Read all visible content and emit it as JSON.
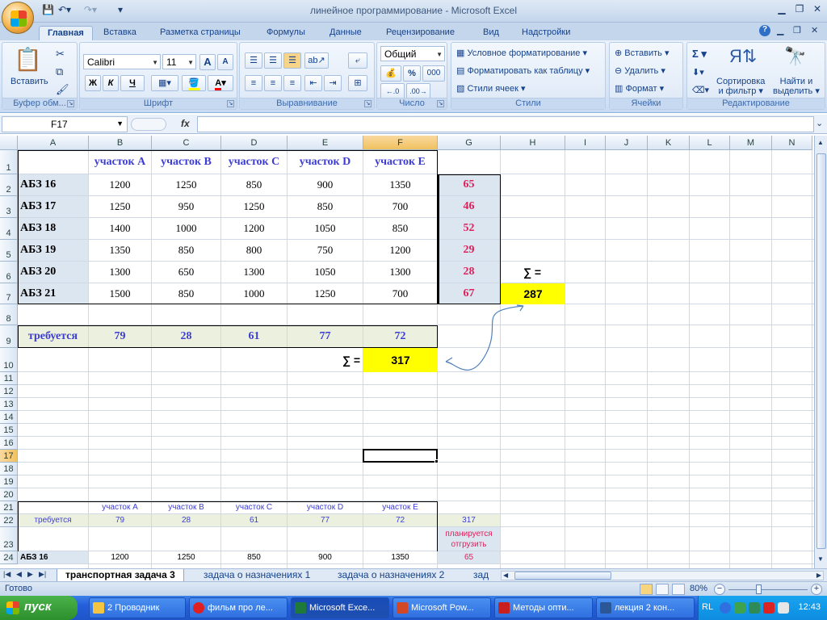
{
  "window": {
    "title": "линейное программирование - Microsoft Excel"
  },
  "ribbon_tabs": [
    "Главная",
    "Вставка",
    "Разметка страницы",
    "Формулы",
    "Данные",
    "Рецензирование",
    "Вид",
    "Надстройки"
  ],
  "ribbon": {
    "clipboard": {
      "paste": "Вставить",
      "label": "Буфер обм..."
    },
    "font": {
      "name": "Calibri",
      "size": "11",
      "bold": "Ж",
      "italic": "К",
      "underline": "Ч",
      "grow": "A",
      "shrink": "A",
      "color_letter": "A",
      "label": "Шрифт"
    },
    "alignment": {
      "label": "Выравнивание"
    },
    "number": {
      "format": "Общий",
      "percent": "%",
      "thousands": "000",
      "label": "Число"
    },
    "styles": {
      "conditional": "Условное форматирование",
      "as_table": "Форматировать как таблицу",
      "cell_styles": "Стили ячеек",
      "label": "Стили"
    },
    "cells": {
      "insert": "Вставить",
      "delete": "Удалить",
      "format": "Формат",
      "label": "Ячейки"
    },
    "editing": {
      "sum": "Σ",
      "sort": "Сортировка\nи фильтр",
      "sort1": "Сортировка",
      "sort2": "и фильтр",
      "find1": "Найти и",
      "find2": "выделить",
      "label": "Редактирование"
    }
  },
  "formula_bar": {
    "name_box": "F17",
    "fx": "fx",
    "value": ""
  },
  "columns": [
    "A",
    "B",
    "C",
    "D",
    "E",
    "F",
    "G",
    "H",
    "I",
    "J",
    "K",
    "L",
    "M",
    "N"
  ],
  "rows": [
    "1",
    "2",
    "3",
    "4",
    "5",
    "6",
    "7",
    "8",
    "9",
    "10",
    "11",
    "12",
    "13",
    "14",
    "15",
    "16",
    "17",
    "18",
    "19",
    "20",
    "21",
    "22",
    "23",
    "24"
  ],
  "selected_cell": {
    "col": "F",
    "row": "17"
  },
  "table1": {
    "headers": [
      "участок A",
      "участок B",
      "участок C",
      "участок D",
      "участок E"
    ],
    "rows": [
      {
        "label": "АБЗ 16",
        "values": [
          "1200",
          "1250",
          "850",
          "900",
          "1350"
        ],
        "supply": "65"
      },
      {
        "label": "АБЗ 17",
        "values": [
          "1250",
          "950",
          "1250",
          "850",
          "700"
        ],
        "supply": "46"
      },
      {
        "label": "АБЗ 18",
        "values": [
          "1400",
          "1000",
          "1200",
          "1050",
          "850"
        ],
        "supply": "52"
      },
      {
        "label": "АБЗ 19",
        "values": [
          "1350",
          "850",
          "800",
          "750",
          "1200"
        ],
        "supply": "29"
      },
      {
        "label": "АБЗ 20",
        "values": [
          "1300",
          "650",
          "1300",
          "1050",
          "1300"
        ],
        "supply": "28"
      },
      {
        "label": "АБЗ 21",
        "values": [
          "1500",
          "850",
          "1000",
          "1250",
          "700"
        ],
        "supply": "67"
      }
    ],
    "required_label": "требуется",
    "required": [
      "79",
      "28",
      "61",
      "77",
      "72"
    ],
    "supply_sum_label": "∑ =",
    "supply_sum": "287",
    "demand_sum_label": "∑ =",
    "demand_sum": "317"
  },
  "table2": {
    "headers": [
      "участок A",
      "участок B",
      "участок C",
      "участок D",
      "участок E"
    ],
    "required_label": "требуется",
    "required": [
      "79",
      "28",
      "61",
      "77",
      "72"
    ],
    "total": "317",
    "planned1": "планируется",
    "planned2": "отгрузить",
    "row24_label": "АБЗ 16",
    "row24_values": [
      "1200",
      "1250",
      "850",
      "900",
      "1350"
    ],
    "row24_supply": "65"
  },
  "sheets": [
    "транспортная задача 3",
    "задача о назначениях 1",
    "задача о назначениях 2",
    "зад"
  ],
  "status": {
    "ready": "Готово",
    "zoom": "80%"
  },
  "taskbar": {
    "start": "пуск",
    "items": [
      "2 Проводник",
      "фильм про ле...",
      "Microsoft Exce...",
      "Microsoft Pow...",
      "Методы опти...",
      "лекция 2 кон..."
    ],
    "lang": "RL",
    "clock": "12:43"
  },
  "colors": {
    "header_blue": "#3d3dd6",
    "supply_pink": "#e0205a",
    "highlight_yellow": "#ffff00",
    "row_fill": "#dce6f1",
    "req_fill": "#ebf1de"
  }
}
